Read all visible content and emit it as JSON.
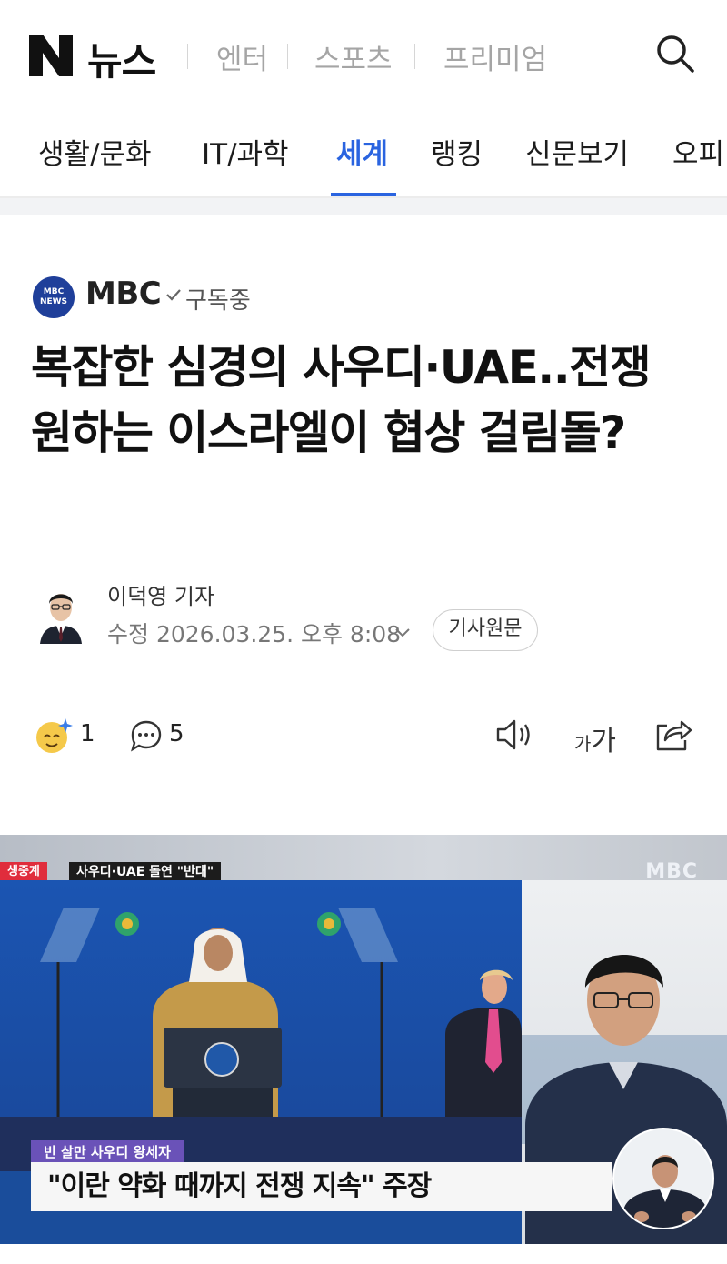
{
  "header": {
    "logo_letter": "N",
    "logo_text": "뉴스",
    "links": [
      "엔터",
      "스포츠",
      "프리미엄"
    ]
  },
  "categories": {
    "items": [
      "생활/문화",
      "IT/과학",
      "세계",
      "랭킹",
      "신문보기",
      "오피"
    ],
    "active": "세계"
  },
  "press": {
    "logo_text": "MBC NEWS",
    "name": "MBC",
    "subscribe_label": "구독중"
  },
  "article": {
    "headline": "복잡한 심경의 사우디·UAE..전쟁 원하는 이스라엘이 협상 걸림돌?",
    "reporter": "이덕영 기자",
    "modified": "수정 2026.03.25. 오후 8:08",
    "original_button": "기사원문"
  },
  "reactions": {
    "emoji_count": "1",
    "comment_count": "5",
    "font_icon_small": "가",
    "font_icon_large": "가"
  },
  "video": {
    "live_tag": "생중계",
    "topic_tag": "사우디·UAE 돌연 \"반대\"",
    "watermark": "MBC",
    "caption_name": "빈 살만 사우디 왕세자",
    "caption": "\"이란 약화 때까지 전쟁 지속\" 주장"
  },
  "colors": {
    "accent": "#2a64e0",
    "press_logo": "#1f3f9a",
    "live_red": "#e02d3c",
    "caption_purple": "#6a52b8"
  }
}
